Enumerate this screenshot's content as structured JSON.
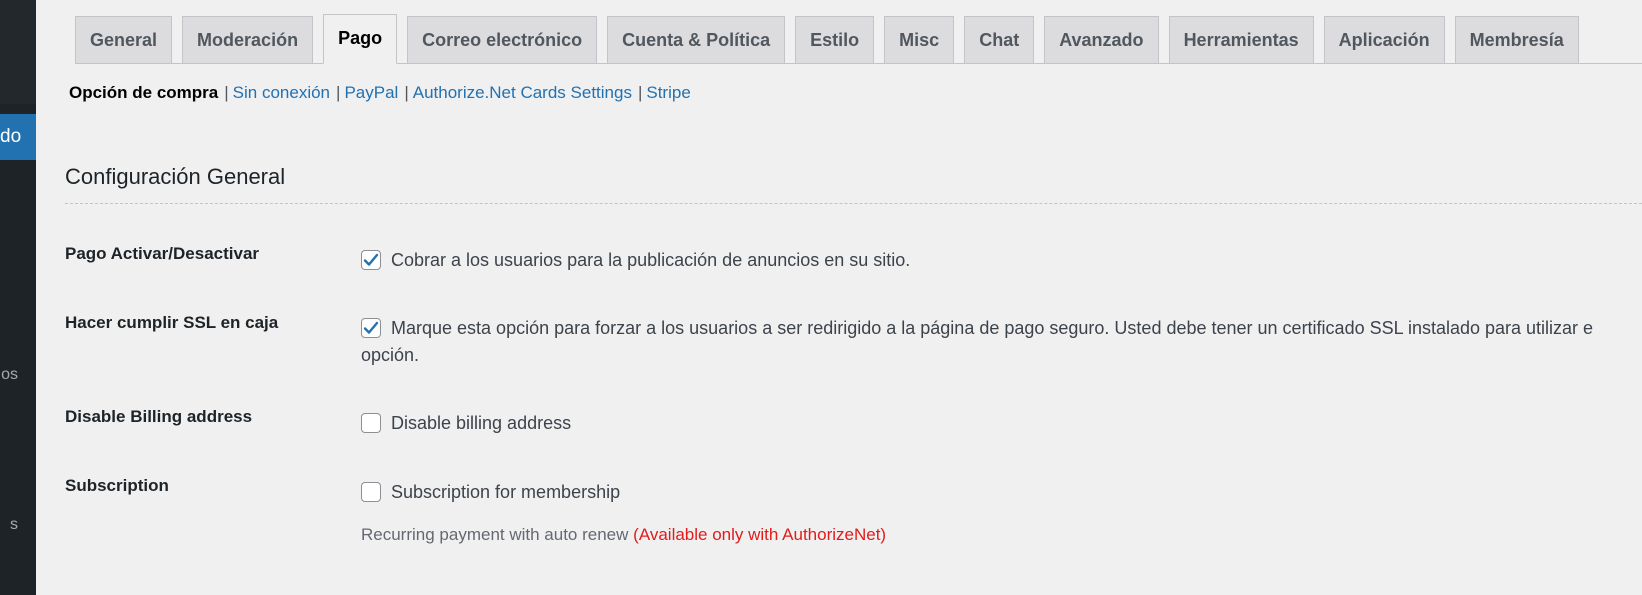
{
  "sidebar": {
    "current_label": "do",
    "items": [
      {
        "label": "os"
      },
      {
        "label": "s"
      }
    ]
  },
  "tabs": [
    {
      "label": "General",
      "active": false
    },
    {
      "label": "Moderación",
      "active": false
    },
    {
      "label": "Pago",
      "active": true
    },
    {
      "label": "Correo electrónico",
      "active": false
    },
    {
      "label": "Cuenta & Política",
      "active": false
    },
    {
      "label": "Estilo",
      "active": false
    },
    {
      "label": "Misc",
      "active": false
    },
    {
      "label": "Chat",
      "active": false
    },
    {
      "label": "Avanzado",
      "active": false
    },
    {
      "label": "Herramientas",
      "active": false
    },
    {
      "label": "Aplicación",
      "active": false
    },
    {
      "label": "Membresía",
      "active": false
    }
  ],
  "subnav": {
    "current": "Opción de compra",
    "separator": "|",
    "links": [
      "Sin conexión",
      "PayPal",
      "Authorize.Net Cards Settings",
      "Stripe"
    ]
  },
  "section": {
    "title": "Configuración General"
  },
  "settings": [
    {
      "label": "Pago Activar/Desactivar",
      "checked": true,
      "text": "Cobrar a los usuarios para la publicación de anuncios en su sitio."
    },
    {
      "label": "Hacer cumplir SSL en caja",
      "checked": true,
      "text": "Marque esta opción para forzar a los usuarios a ser redirigido a la página de pago seguro. Usted debe tener un certificado SSL instalado para utilizar e",
      "text_line2": "opción."
    },
    {
      "label": "Disable Billing address",
      "checked": false,
      "text": "Disable billing address"
    },
    {
      "label": "Subscription",
      "checked": false,
      "text": "Subscription for membership"
    }
  ],
  "note": {
    "text": "Recurring payment with auto renew",
    "warning": "(Available only with AuthorizeNet)"
  },
  "colors": {
    "accent": "#2271b1",
    "warning": "#e31b1b",
    "background": "#f0f0f1",
    "sidebar": "#1d2327"
  }
}
